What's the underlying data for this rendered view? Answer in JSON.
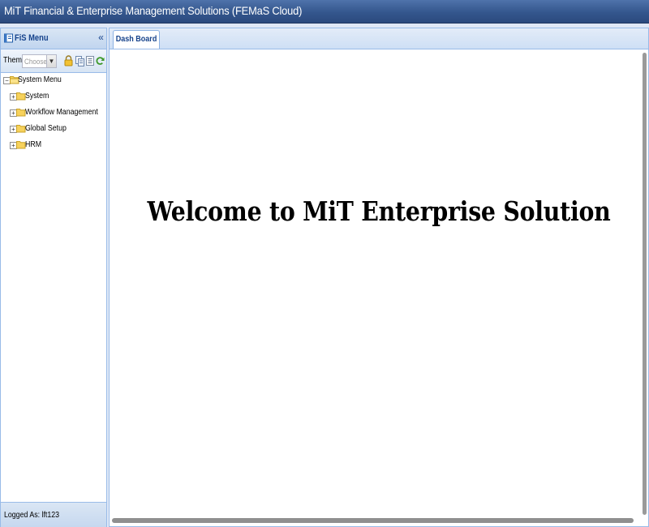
{
  "window": {
    "title": "MiT Financial & Enterprise Management Solutions (FEMaS Cloud)"
  },
  "west_panel": {
    "header_title": "FiS Menu",
    "collapse_glyph": "«",
    "theme_label": "Theme:",
    "theme_placeholder": "Choose Ti",
    "toolbar_icons": [
      "lock-icon",
      "copy-icon",
      "list-icon",
      "refresh-icon"
    ],
    "tree": {
      "root": {
        "label": "System Menu",
        "expanded": true
      },
      "children": [
        {
          "label": "System"
        },
        {
          "label": "Workflow Management"
        },
        {
          "label": "Global Setup"
        },
        {
          "label": "HRM"
        }
      ]
    },
    "footer": {
      "logged_in_text": "Logged As: lft123"
    }
  },
  "tabs": [
    {
      "label": "Dash Board",
      "active": true
    }
  ],
  "main": {
    "welcome_text": "Welcome to MiT Enterprise Solution"
  },
  "colors": {
    "title_bar": "#3a5f98",
    "panel_border": "#99bbe8",
    "header_text": "#15428b",
    "folder": "#f7d25c"
  }
}
